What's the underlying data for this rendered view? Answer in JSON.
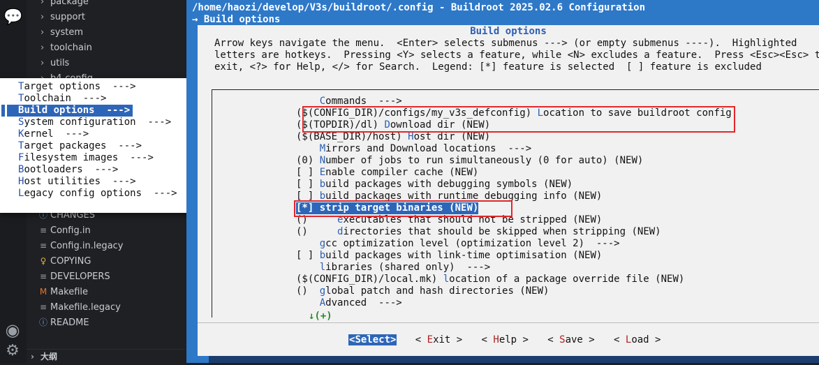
{
  "activity": {
    "top_icon": "chat-icon",
    "bottom_icon": "account-icon",
    "gear_icon": "gear-icon"
  },
  "explorer": {
    "folders_top": [
      {
        "label": "package"
      },
      {
        "label": "support"
      },
      {
        "label": "system"
      },
      {
        "label": "toolchain"
      },
      {
        "label": "utils"
      },
      {
        "label": "b4-config"
      }
    ],
    "files": [
      {
        "label": "CHANGES",
        "icon": "info-icon",
        "icon_char": "ⓘ",
        "color": "#7aa6d8"
      },
      {
        "label": "Config.in",
        "icon": "lines-icon",
        "icon_char": "≡",
        "color": "#9aa0a6"
      },
      {
        "label": "Config.in.legacy",
        "icon": "lines-icon",
        "icon_char": "≡",
        "color": "#9aa0a6"
      },
      {
        "label": "COPYING",
        "icon": "license-icon",
        "icon_char": "♀",
        "color": "#e0b32f"
      },
      {
        "label": "DEVELOPERS",
        "icon": "lines-icon",
        "icon_char": "≡",
        "color": "#9aa0a6"
      },
      {
        "label": "Makefile",
        "icon": "makefile-icon",
        "icon_char": "M",
        "color": "#e0762c"
      },
      {
        "label": "Makefile.legacy",
        "icon": "lines-icon",
        "icon_char": "≡",
        "color": "#9aa0a6"
      },
      {
        "label": "README",
        "icon": "info-icon",
        "icon_char": "ⓘ",
        "color": "#7aa6d8"
      }
    ],
    "outline_label": "大纲"
  },
  "dropdown": {
    "items": [
      {
        "hk": "T",
        "rest": "arget options  --->",
        "selected": false
      },
      {
        "hk": "T",
        "rest": "oolchain  --->",
        "selected": false
      },
      {
        "hk": "B",
        "rest": "uild options  --->",
        "selected": true
      },
      {
        "hk": "S",
        "rest": "ystem configuration  --->",
        "selected": false
      },
      {
        "hk": "K",
        "rest": "ernel  --->",
        "selected": false
      },
      {
        "hk": "T",
        "rest": "arget packages  --->",
        "selected": false
      },
      {
        "hk": "F",
        "rest": "ilesystem images  --->",
        "selected": false
      },
      {
        "hk": "B",
        "rest": "ootloaders  --->",
        "selected": false
      },
      {
        "hk": "H",
        "rest": "ost utilities  --->",
        "selected": false
      },
      {
        "hk": "L",
        "rest": "egacy config options  --->",
        "selected": false
      }
    ]
  },
  "terminal": {
    "title": "/home/haozi/develop/V3s/buildroot/.config - Buildroot 2025.02.6 Configuration",
    "breadcrumb": "→ Build options",
    "dialog_title": "Build options",
    "help_lines": [
      "Arrow keys navigate the menu.  <Enter> selects submenus ---> (or empty submenus ----).  Highlighted",
      "letters are hotkeys.  Pressing <Y> selects a feature, while <N> excludes a feature.  Press <Esc><Esc> to",
      "exit, <?> for Help, </> for Search.  Legend: [*] feature is selected  [ ] feature is excluded"
    ],
    "menu": [
      {
        "pre": "    ",
        "hk": "C",
        "post": "ommands  --->"
      },
      {
        "pre": "($(CONFIG_DIR)/configs/my_v3s_defconfig) ",
        "hk": "L",
        "post": "ocation to save buildroot config"
      },
      {
        "pre": "($(TOPDIR)/dl) ",
        "hk": "D",
        "post": "ownload dir (NEW)"
      },
      {
        "pre": "($(BASE_DIR)/host) ",
        "hk": "H",
        "post": "ost dir (NEW)"
      },
      {
        "pre": "    ",
        "hk": "M",
        "post": "irrors and Download locations  --->"
      },
      {
        "pre": "(0) ",
        "hk": "N",
        "post": "umber of jobs to run simultaneously (0 for auto) (NEW)"
      },
      {
        "pre": "[ ] ",
        "hk": "E",
        "post": "nable compiler cache (NEW)"
      },
      {
        "pre": "[ ] ",
        "hk": "b",
        "post": "uild packages with debugging symbols (NEW)"
      },
      {
        "pre": "[ ] ",
        "hk": "b",
        "post": "uild packages with runtime debugging info (NEW)"
      },
      {
        "pre": "[*] ",
        "hk": "s",
        "post": "trip target binaries (NEW)",
        "selected": true
      },
      {
        "pre": "()     ",
        "hk": "e",
        "post": "xecutables that should not be stripped (NEW)"
      },
      {
        "pre": "()     ",
        "hk": "d",
        "post": "irectories that should be skipped when stripping (NEW)"
      },
      {
        "pre": "    ",
        "hk": "g",
        "post": "cc optimization level (optimization level 2)  --->"
      },
      {
        "pre": "[ ] ",
        "hk": "b",
        "post": "uild packages with link-time optimisation (NEW)"
      },
      {
        "pre": "    ",
        "hk": "l",
        "post": "ibraries (shared only)  --->"
      },
      {
        "pre": "($(CONFIG_DIR)/local.mk) ",
        "hk": "l",
        "post": "ocation of a package override file (NEW)"
      },
      {
        "pre": "()  ",
        "hk": "g",
        "post": "lobal patch and hash directories (NEW)"
      },
      {
        "pre": "    ",
        "hk": "A",
        "post": "dvanced  --->"
      }
    ],
    "more_indicator": "↓(+)",
    "buttons": [
      {
        "open": "<",
        "hk": "S",
        "rest": "elect",
        "close": ">",
        "selected": true
      },
      {
        "open": "< ",
        "hk": "E",
        "rest": "xit",
        "close": " >",
        "selected": false
      },
      {
        "open": "< ",
        "hk": "H",
        "rest": "elp",
        "close": " >",
        "selected": false
      },
      {
        "open": "< ",
        "hk": "S",
        "rest": "ave",
        "close": " >",
        "selected": false
      },
      {
        "open": "< ",
        "hk": "L",
        "rest": "oad",
        "close": " >",
        "selected": false
      }
    ]
  }
}
